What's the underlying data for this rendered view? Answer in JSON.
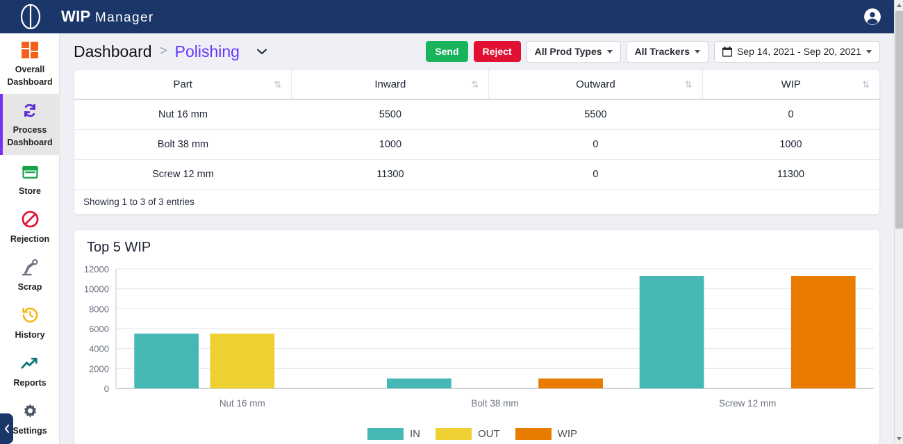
{
  "app": {
    "brand_bold": "WIP",
    "brand_light": "Manager",
    "logo_icon": "ellipse-line-logo",
    "account_icon": "account-circle-icon"
  },
  "sidebar": {
    "items": [
      {
        "label": "Overall\nDashboard",
        "icon": "grid-dashboard-icon",
        "active": false
      },
      {
        "label": "Process\nDashboard",
        "icon": "refresh-cycle-icon",
        "active": true
      },
      {
        "label": "Store",
        "icon": "store-icon",
        "active": false
      },
      {
        "label": "Rejection",
        "icon": "no-entry-icon",
        "active": false
      },
      {
        "label": "Scrap",
        "icon": "robot-arm-icon",
        "active": false
      },
      {
        "label": "History",
        "icon": "history-clock-icon",
        "active": false
      },
      {
        "label": "Reports",
        "icon": "trending-up-icon",
        "active": false
      },
      {
        "label": "Settings",
        "icon": "gear-icon",
        "active": false
      }
    ],
    "collapse_icon": "chevron-left-icon"
  },
  "breadcrumb": {
    "root": "Dashboard",
    "separator": ">",
    "current": "Polishing",
    "chevron_icon": "chevron-down-icon"
  },
  "toolbar": {
    "send_label": "Send",
    "reject_label": "Reject",
    "prod_types_label": "All Prod Types",
    "trackers_label": "All Trackers",
    "date_range_label": "Sep 14, 2021 - Sep 20, 2021",
    "calendar_icon": "calendar-icon",
    "send_color": "#18b35b",
    "reject_color": "#e01133"
  },
  "table": {
    "columns": [
      "Part",
      "Inward",
      "Outward",
      "WIP"
    ],
    "sort_icon": "sort-updown-icon",
    "rows": [
      {
        "part": "Nut 16 mm",
        "inward": "5500",
        "outward": "5500",
        "wip": "0"
      },
      {
        "part": "Bolt 38 mm",
        "inward": "1000",
        "outward": "0",
        "wip": "1000"
      },
      {
        "part": "Screw 12 mm",
        "inward": "11300",
        "outward": "0",
        "wip": "11300"
      }
    ],
    "footer": "Showing 1 to 3 of 3 entries"
  },
  "chart_data": {
    "type": "bar",
    "title": "Top 5 WIP",
    "categories": [
      "Nut 16 mm",
      "Bolt 38 mm",
      "Screw 12 mm"
    ],
    "series": [
      {
        "name": "IN",
        "color": "#45b8b5",
        "values": [
          5500,
          1000,
          11300
        ]
      },
      {
        "name": "OUT",
        "color": "#efd033",
        "values": [
          5500,
          0,
          0
        ]
      },
      {
        "name": "WIP",
        "color": "#e87b00",
        "values": [
          0,
          1000,
          11300
        ]
      }
    ],
    "xlabel": "",
    "ylabel": "",
    "ylim": [
      0,
      12000
    ],
    "yticks": [
      0,
      2000,
      4000,
      6000,
      8000,
      10000,
      12000
    ],
    "ytick_labels": [
      "0",
      "2000",
      "4000",
      "6000",
      "8000",
      "10000",
      "12000"
    ],
    "grid": true,
    "legend_position": "bottom"
  },
  "scrollbar": {
    "up_icon": "triangle-up-icon",
    "down_icon": "triangle-down-icon"
  }
}
